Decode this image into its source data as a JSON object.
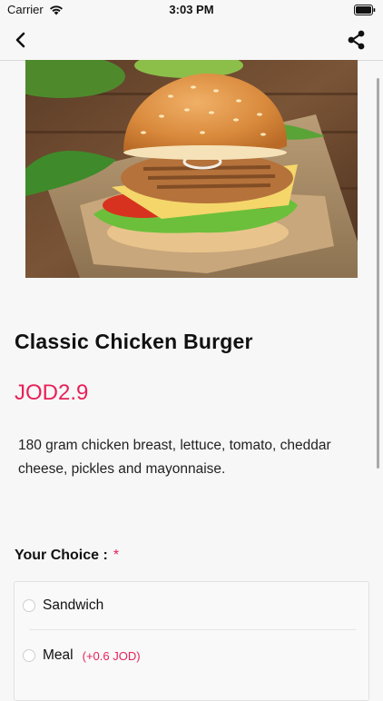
{
  "status_bar": {
    "carrier": "Carrier",
    "time": "3:03 PM"
  },
  "nav": {
    "back_icon": "chevron-left",
    "share_icon": "share"
  },
  "product": {
    "image": "classic-chicken-burger-photo",
    "title": "Classic Chicken Burger",
    "price": "JOD2.9",
    "description": "180 gram chicken breast, lettuce, tomato, cheddar cheese, pickles and mayonnaise."
  },
  "choice": {
    "heading": "Your Choice :",
    "required_mark": "*",
    "options": [
      {
        "label": "Sandwich",
        "extra": ""
      },
      {
        "label": "Meal",
        "extra": "(+0.6 JOD)"
      }
    ]
  },
  "colors": {
    "accent": "#e7215a",
    "background": "#f7f7f7"
  }
}
